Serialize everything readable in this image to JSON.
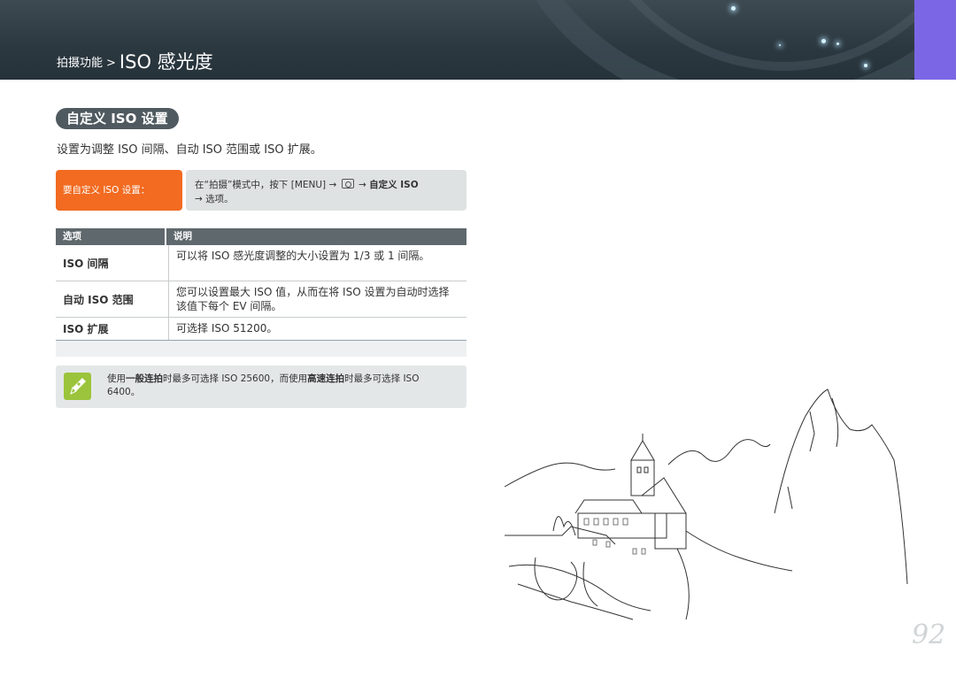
{
  "header": {
    "breadcrumb_parent": "拍摄功能",
    "breadcrumb_separator": ">",
    "page_title": "ISO 感光度",
    "accent_color": "#7b67e6"
  },
  "section": {
    "title": "自定义 ISO 设置",
    "intro": "设置为调整 ISO 间隔、自动 ISO 范围或 ISO 扩展。"
  },
  "howto": {
    "badge": "要自定义 ISO 设置：",
    "text_prefix": "在“拍摄”模式中，按下 [MENU] →",
    "camera_icon": "camera-icon",
    "arrow": "→",
    "text_bold": "自定义 ISO",
    "text_line2": "→ 选项。",
    "badge_color": "#f26b21"
  },
  "table": {
    "headers": [
      "选项",
      "说明"
    ],
    "rows": [
      {
        "option": "ISO 间隔",
        "description": "可以将 ISO 感光度调整的大小设置为 1/3 或 1 间隔。"
      },
      {
        "option": "自动 ISO 范围",
        "description": "您可以设置最大 ISO 值，从而在将 ISO 设置为自动时选择该值下每个 EV 间隔。"
      },
      {
        "option": "ISO 扩展",
        "description": "可选择 ISO 51200。"
      }
    ]
  },
  "note": {
    "icon": "pen-note-icon",
    "part1": "使用",
    "bold1": "一般连拍",
    "part2": "时最多可选择 ISO 25600，而使用",
    "bold2": "高速连拍",
    "part3": "时最多可选择 ISO 6400。",
    "icon_color": "#9bc43c"
  },
  "page_number": "92"
}
